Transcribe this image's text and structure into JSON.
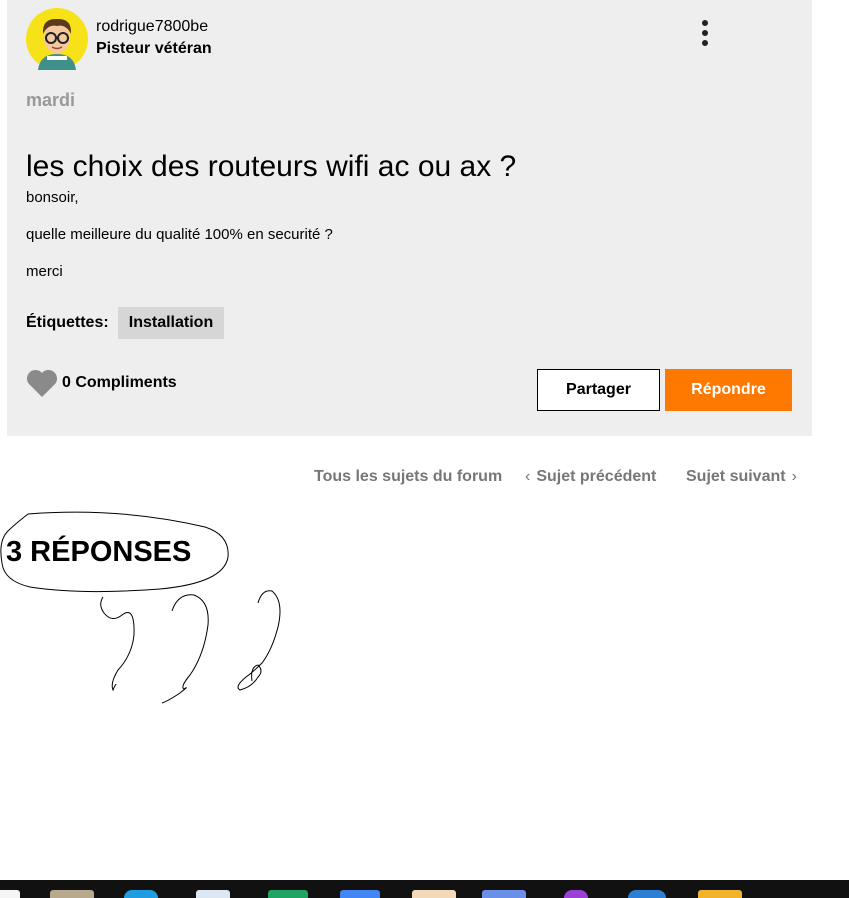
{
  "post": {
    "username": "rodrigue7800be",
    "rank": "Pisteur vétéran",
    "date": "mardi",
    "title": "les choix des routeurs wifi ac ou ax ?",
    "body": [
      "bonsoir,",
      "quelle meilleure du qualité 100% en securité ?",
      "merci"
    ],
    "tags_label": "Étiquettes:",
    "tags": [
      "Installation"
    ],
    "kudos": "0 Compliments",
    "share_label": "Partager",
    "reply_label": "Répondre"
  },
  "navigation": {
    "all_topics": "Tous les sujets du forum",
    "previous": "Sujet précédent",
    "next": "Sujet suivant"
  },
  "replies_heading": "3 RÉPONSES",
  "icons": [
    "avatar",
    "more-options-icon",
    "heart-icon",
    "chevron-left-icon",
    "chevron-right-icon"
  ],
  "colors": {
    "accent": "#ff7900",
    "card_bg": "#eeeeee",
    "tag_bg": "#d6d6d6",
    "muted": "#777777"
  },
  "taskbar_icons": [
    "file-icon",
    "folder-icon",
    "edge-icon",
    "dropbox-icon",
    "sheets-icon",
    "docs-icon",
    "store-icon",
    "mail-icon",
    "app-icon",
    "browser-icon",
    "files-icon"
  ]
}
